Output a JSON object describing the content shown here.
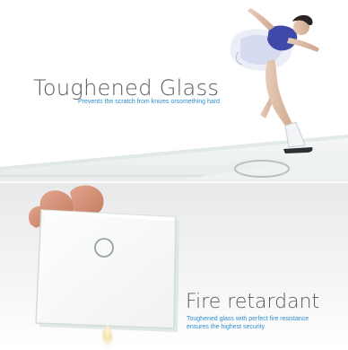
{
  "top_panel": {
    "title": "Toughened Glass",
    "subtitle": "Prevents the scratch from knives orsomething hard"
  },
  "bottom_panel": {
    "title": "Fire retardant",
    "subtitle_line1": "Toughened glass with perfect fire resistance",
    "subtitle_line2": "ensures the highest  security"
  },
  "colors": {
    "title": "#555b63",
    "subtitle": "#2d8fd0",
    "glass_edge": "#cfe0d6"
  }
}
